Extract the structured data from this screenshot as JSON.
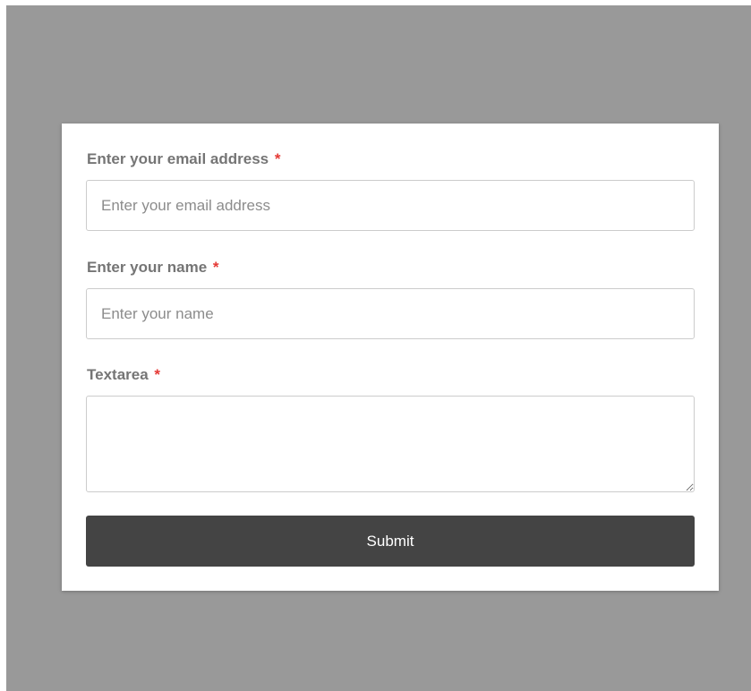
{
  "form": {
    "email": {
      "label": "Enter your email address",
      "required_mark": "*",
      "placeholder": "Enter your email address",
      "value": ""
    },
    "name": {
      "label": "Enter your name",
      "required_mark": "*",
      "placeholder": "Enter your name",
      "value": ""
    },
    "textarea": {
      "label": "Textarea",
      "required_mark": "*",
      "value": ""
    },
    "submit_label": "Submit"
  },
  "colors": {
    "backdrop": "#999999",
    "card": "#ffffff",
    "label": "#757575",
    "required": "#e53935",
    "button": "#444444",
    "button_text": "#ffffff",
    "border": "#cccccc"
  }
}
